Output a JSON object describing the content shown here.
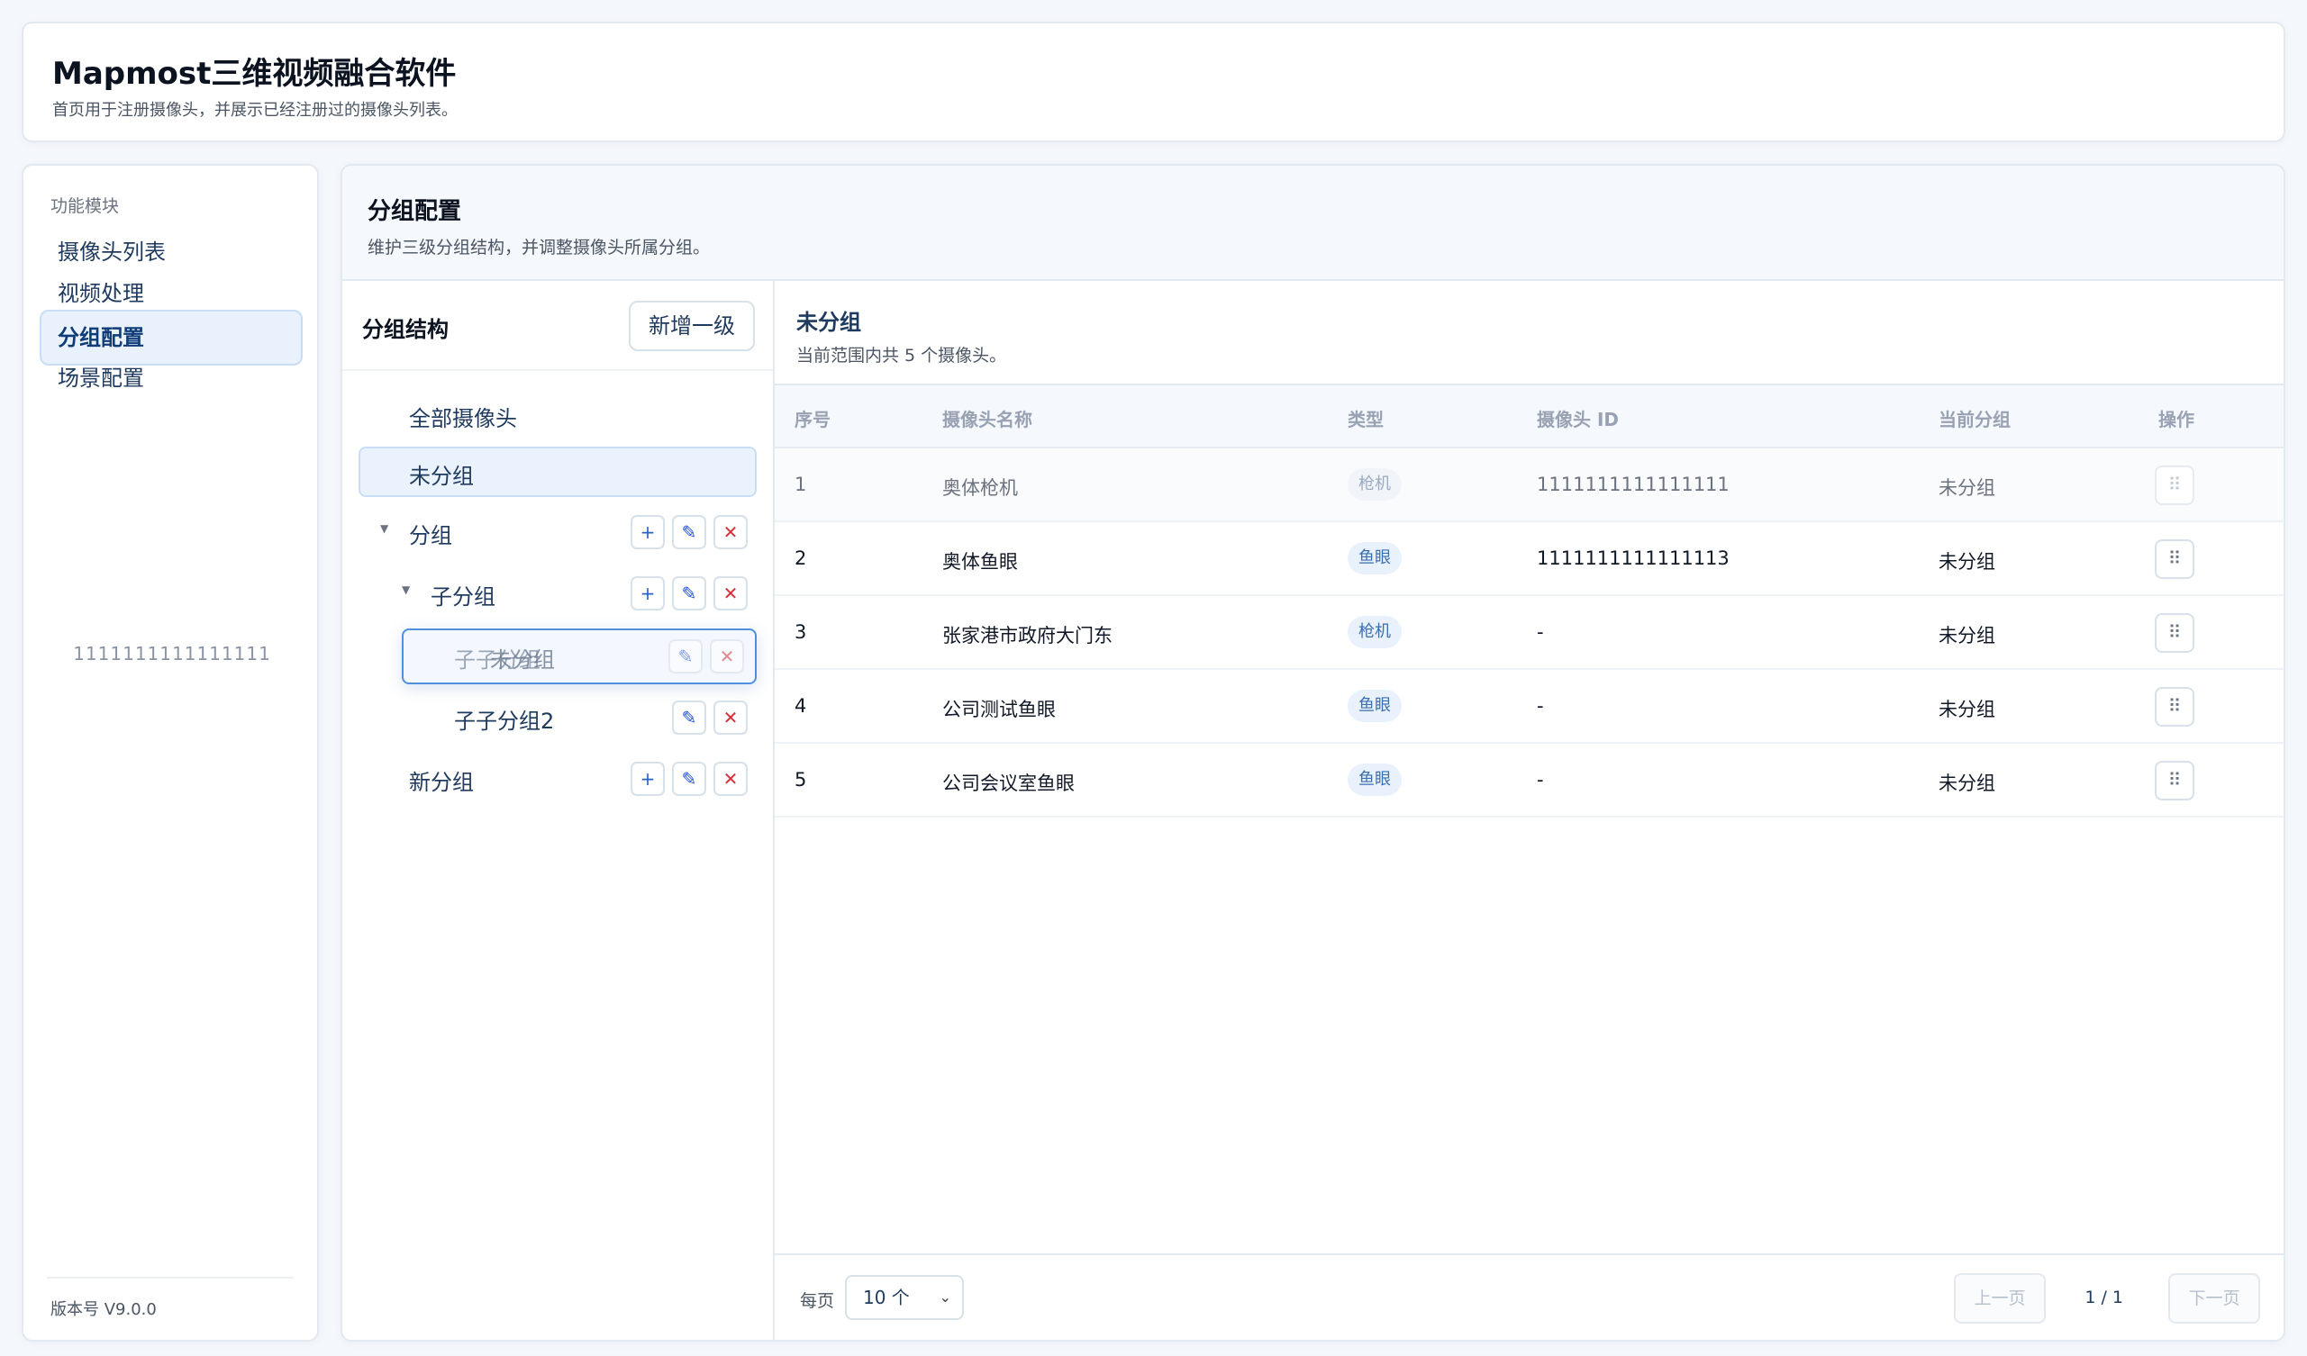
{
  "header": {
    "title": "Mapmost三维视频融合软件",
    "description": "首页用于注册摄像头，并展示已经注册过的摄像头列表。"
  },
  "sidebar": {
    "section_label": "功能模块",
    "items": [
      {
        "label": "摄像头列表",
        "active": false
      },
      {
        "label": "视频处理",
        "active": false
      },
      {
        "label": "分组配置",
        "active": true
      },
      {
        "label": "场景配置",
        "active": false
      }
    ],
    "floating_text": "1111111111111111",
    "version": "版本号 V9.0.0"
  },
  "main": {
    "title": "分组配置",
    "description": "维护三级分组结构，并调整摄像头所属分组。"
  },
  "tree": {
    "title": "分组结构",
    "add_root_label": "新增一级",
    "nodes": [
      {
        "label": "全部摄像头"
      },
      {
        "label": "未分组"
      },
      {
        "label": "分组"
      },
      {
        "label": "子分组"
      },
      {
        "label": "子子分组",
        "ghost_label": "未分组"
      },
      {
        "label": "子子分组2"
      },
      {
        "label": "新分组"
      }
    ],
    "icons": {
      "add": "plus-icon",
      "edit": "pencil-icon",
      "delete": "close-icon",
      "expand": "caret-down-icon"
    }
  },
  "list": {
    "title": "未分组",
    "count_text": "当前范围内共 5 个摄像头。",
    "columns": [
      "序号",
      "摄像头名称",
      "类型",
      "摄像头 ID",
      "当前分组",
      "操作"
    ],
    "rows": [
      {
        "index": "1",
        "name": "奥体枪机",
        "type": "枪机",
        "id": "1111111111111111",
        "group": "未分组"
      },
      {
        "index": "2",
        "name": "奥体鱼眼",
        "type": "鱼眼",
        "id": "1111111111111113",
        "group": "未分组"
      },
      {
        "index": "3",
        "name": "张家港市政府大门东",
        "type": "枪机",
        "id": "-",
        "group": "未分组"
      },
      {
        "index": "4",
        "name": "公司测试鱼眼",
        "type": "鱼眼",
        "id": "-",
        "group": "未分组"
      },
      {
        "index": "5",
        "name": "公司会议室鱼眼",
        "type": "鱼眼",
        "id": "-",
        "group": "未分组"
      }
    ],
    "op_icon": "drag-handle-icon"
  },
  "pagination": {
    "per_page_label": "每页",
    "per_page_value": "10 个",
    "prev_label": "上一页",
    "page_info": "1 / 1",
    "next_label": "下一页"
  }
}
